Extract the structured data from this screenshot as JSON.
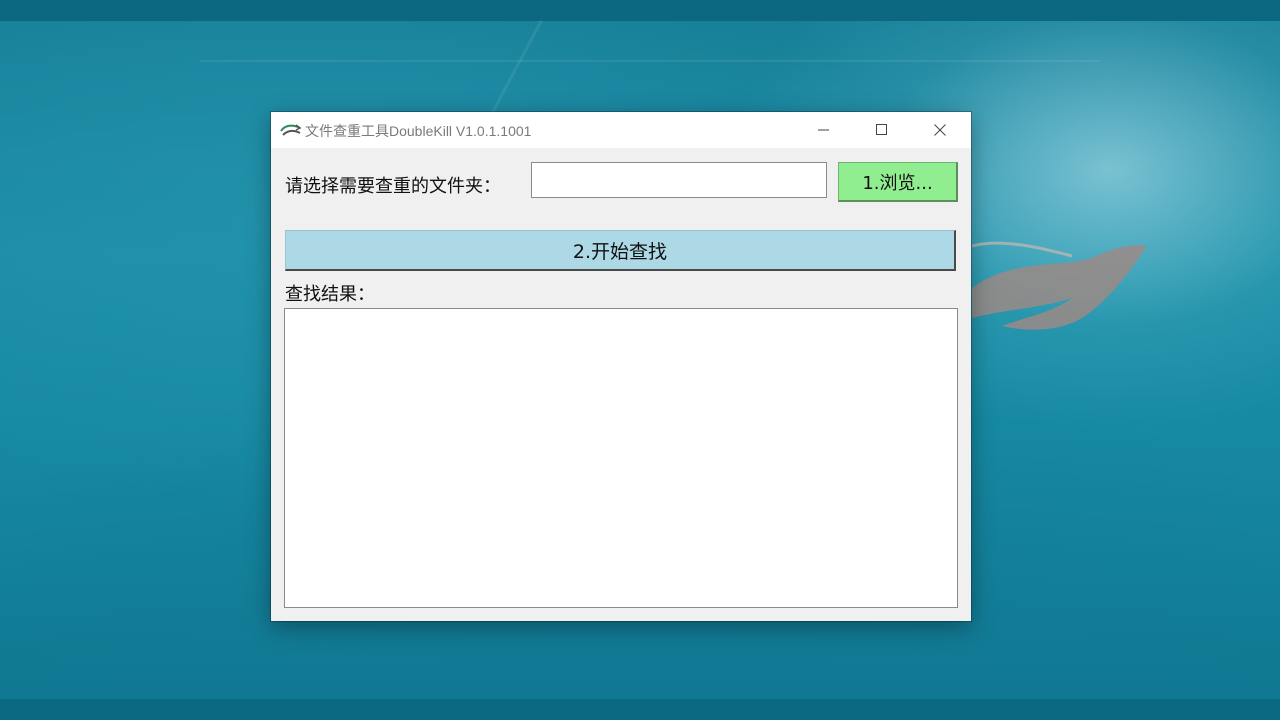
{
  "window": {
    "title": "文件查重工具DoubleKill  V1.0.1.1001",
    "controls": {
      "minimize_icon": "minimize-icon",
      "maximize_icon": "maximize-icon",
      "close_icon": "close-icon"
    }
  },
  "form": {
    "folder_label": "请选择需要查重的文件夹：",
    "folder_input_value": "",
    "browse_button": "1.浏览...",
    "start_button": "2.开始查找",
    "results_label": "查找结果：",
    "results_text": ""
  },
  "colors": {
    "browse_button_bg": "#90ee90",
    "start_button_bg": "#add8e6",
    "window_bg": "#f0f0f0",
    "titlebar_bg": "#ffffff"
  }
}
